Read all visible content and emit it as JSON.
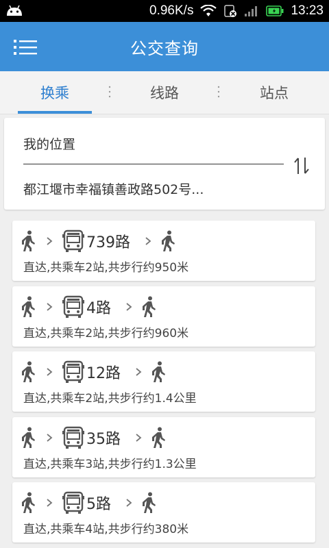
{
  "status_bar": {
    "speed": "0.96K/s",
    "time": "13:23",
    "icons": [
      "android-icon",
      "wifi-icon",
      "sim-icon",
      "signal-icon",
      "battery-icon"
    ]
  },
  "app_bar": {
    "title": "公交查询",
    "menu_icon": "menu-icon"
  },
  "tabs": [
    {
      "label": "换乘",
      "active": true
    },
    {
      "label": "线路",
      "active": false
    },
    {
      "label": "站点",
      "active": false
    }
  ],
  "route": {
    "from": "我的位置",
    "to": "都江堰市幸福镇善政路502号...",
    "swap_icon": "swap-icon"
  },
  "results": [
    {
      "line": "739路",
      "summary": "直达,共乘车2站,共步行约950米"
    },
    {
      "line": "4路",
      "summary": "直达,共乘车2站,共步行约960米"
    },
    {
      "line": "12路",
      "summary": "直达,共乘车2站,共步行约1.4公里"
    },
    {
      "line": "35路",
      "summary": "直达,共乘车3站,共步行约1.3公里"
    },
    {
      "line": "5路",
      "summary": "直达,共乘车4站,共步行约380米"
    }
  ],
  "colors": {
    "accent": "#3c8fd8",
    "active_tab_text": "#2e7fcf",
    "status_bar": "#000000",
    "battery": "#39d353"
  }
}
